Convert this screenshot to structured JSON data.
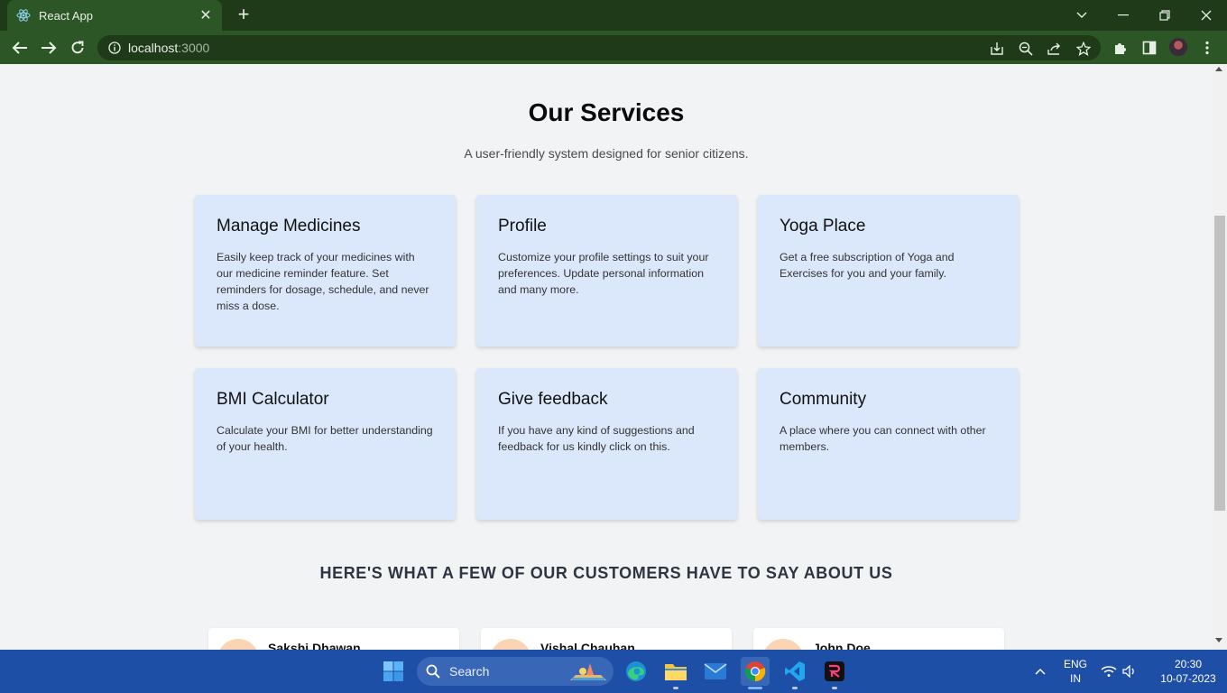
{
  "browser": {
    "tab_title": "React App",
    "url_host": "localhost",
    "url_port": ":3000"
  },
  "services": {
    "title": "Our Services",
    "subtitle": "A user-friendly system designed for senior citizens.",
    "cards": [
      {
        "title": "Manage Medicines",
        "text": "Easily keep track of your medicines with our medicine reminder feature. Set reminders for dosage, schedule, and never miss a dose."
      },
      {
        "title": "Profile",
        "text": "Customize your profile settings to suit your preferences. Update personal information and many more."
      },
      {
        "title": "Yoga Place",
        "text": "Get a free subscription of Yoga and Exercises for you and your family."
      },
      {
        "title": "BMI Calculator",
        "text": "Calculate your BMI for better understanding of your health."
      },
      {
        "title": "Give feedback",
        "text": "If you have any kind of suggestions and feedback for us kindly click on this."
      },
      {
        "title": "Community",
        "text": "A place where you can connect with other members."
      }
    ]
  },
  "testimonials": {
    "heading": "HERE'S WHAT A FEW OF OUR CUSTOMERS HAVE TO SAY ABOUT US",
    "people": [
      {
        "name": "Sakshi Dhawan"
      },
      {
        "name": "Vishal Chauhan"
      },
      {
        "name": "John Doe"
      }
    ]
  },
  "taskbar": {
    "search_label": "Search",
    "lang_top": "ENG",
    "lang_bottom": "IN",
    "time": "20:30",
    "date": "10-07-2023"
  },
  "colors": {
    "chrome_dark": "#1e3a18",
    "chrome_light": "#2d5626",
    "card_bg": "#dbe8fb",
    "taskbar": "#1e4fa6"
  }
}
